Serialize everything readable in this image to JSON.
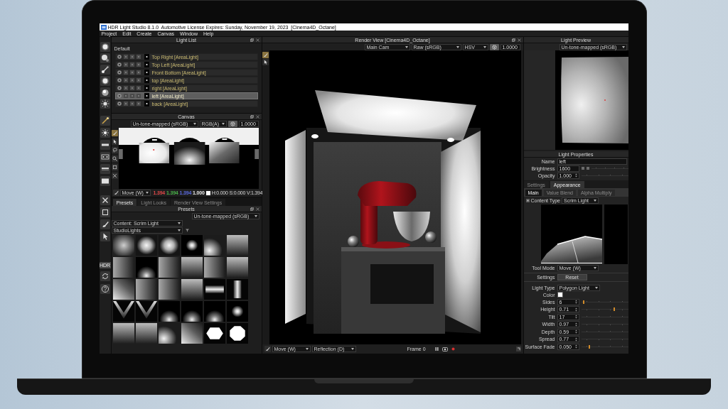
{
  "window": {
    "title": "HDR Light Studio 8.1.0  Automotive License Expires: Sunday, November 19, 2023  [Cinema4D_Octane]"
  },
  "menu": [
    "Project",
    "Edit",
    "Create",
    "Canvas",
    "Window",
    "Help"
  ],
  "toolbar": {
    "badge": "HDR"
  },
  "light_list": {
    "title": "Light List",
    "group": "Default",
    "lights": [
      {
        "name": "Top Right [AreaLight]",
        "selected": false
      },
      {
        "name": "Top Left [AreaLight]",
        "selected": false
      },
      {
        "name": "Front Bottom [AreaLight]",
        "selected": false
      },
      {
        "name": "top [AreaLight]",
        "selected": false
      },
      {
        "name": "right [AreaLight]",
        "selected": false
      },
      {
        "name": "left [AreaLight]",
        "selected": true
      },
      {
        "name": "back [AreaLight]",
        "selected": false
      }
    ]
  },
  "canvas": {
    "title": "Canvas",
    "tone_mapping": "Un-tone-mapped (sRGB)",
    "channels": "RGB(A)",
    "exposure": "1.0000",
    "tool": "Move (W)",
    "readout": [
      {
        "value": "1.394",
        "color": "#e04848"
      },
      {
        "value": "1.394",
        "color": "#48b048"
      },
      {
        "value": "1.394",
        "color": "#5a6ae0"
      }
    ],
    "alpha": "1.000",
    "sample": {
      "color": "#ffffff"
    },
    "hsv": "H:0.000 S:0.000 V:1.394"
  },
  "bottom_tabs": [
    {
      "label": "Presets",
      "selected": true
    },
    {
      "label": "Light Looks",
      "selected": false
    },
    {
      "label": "Render View Settings",
      "selected": false
    }
  ],
  "presets": {
    "title": "Presets",
    "tone_mapping": "Un-tone-mapped (sRGB)",
    "content": "Content: Scrim Light",
    "library": "StudioLights",
    "tiles": [
      {
        "kind": "soft"
      },
      {
        "kind": "glow"
      },
      {
        "kind": "glow"
      },
      {
        "kind": "spot"
      },
      {
        "kind": "corner"
      },
      {
        "kind": "fade"
      },
      {
        "kind": "side"
      },
      {
        "kind": "cone"
      },
      {
        "kind": "side"
      },
      {
        "kind": "fade"
      },
      {
        "kind": "side"
      },
      {
        "kind": "fade"
      },
      {
        "kind": "diagonal"
      },
      {
        "kind": "side"
      },
      {
        "kind": "side"
      },
      {
        "kind": "fade"
      },
      {
        "kind": "bar"
      },
      {
        "kind": "pillar"
      },
      {
        "kind": "fan"
      },
      {
        "kind": "fan"
      },
      {
        "kind": "cone"
      },
      {
        "kind": "cone"
      },
      {
        "kind": "cone"
      },
      {
        "kind": "spot"
      },
      {
        "kind": "fade"
      },
      {
        "kind": "fade"
      },
      {
        "kind": "corner"
      },
      {
        "kind": "diagonal"
      },
      {
        "kind": "hexagon"
      },
      {
        "kind": "octagon"
      }
    ]
  },
  "render_view": {
    "title": "Render View [Cinema4D_Octane]",
    "camera": "Main Cam",
    "color_space": "Raw (sRGB)",
    "mode": "HSV",
    "exposure": "1.0000",
    "tool": "Move (W)",
    "pick": "Reflection (D)",
    "frame": "Frame 0"
  },
  "light_preview": {
    "title": "Light Preview",
    "tone_mapping": "Un-tone-mapped (sRGB)"
  },
  "light_properties": {
    "title": "Light Properties",
    "name": {
      "label": "Name",
      "value": "left"
    },
    "brightness": {
      "label": "Brightness",
      "value": "1600"
    },
    "opacity": {
      "label": "Opacity",
      "value": "1.000"
    },
    "tabs": [
      {
        "label": "Settings",
        "selected": false
      },
      {
        "label": "Appearance",
        "selected": true
      }
    ],
    "subtabs": [
      {
        "label": "Main",
        "selected": true
      },
      {
        "label": "Value Blend",
        "selected": false
      },
      {
        "label": "Alpha Multiply",
        "selected": false
      }
    ],
    "content_type": {
      "label": "Content Type",
      "value": "Scrim Light"
    },
    "tool_mode": {
      "label": "Tool Mode",
      "value": "Move (W)"
    },
    "settings": {
      "label": "Settings",
      "button": "Reset"
    },
    "light_type": {
      "label": "Light Type",
      "value": "Polygon Light"
    },
    "color": {
      "label": "Color",
      "color": "#ffffff"
    },
    "params": [
      {
        "label": "Sides",
        "value": "6",
        "level": 0.06
      },
      {
        "label": "Height",
        "value": "0.71",
        "level": 0.71
      },
      {
        "label": "Tilt",
        "value": "17"
      },
      {
        "label": "Width",
        "value": "0.97"
      },
      {
        "label": "Depth",
        "value": "0.59"
      },
      {
        "label": "Spread",
        "value": "0.77"
      },
      {
        "label": "Surface Fade",
        "value": "0.050",
        "level": 0.17
      }
    ]
  }
}
